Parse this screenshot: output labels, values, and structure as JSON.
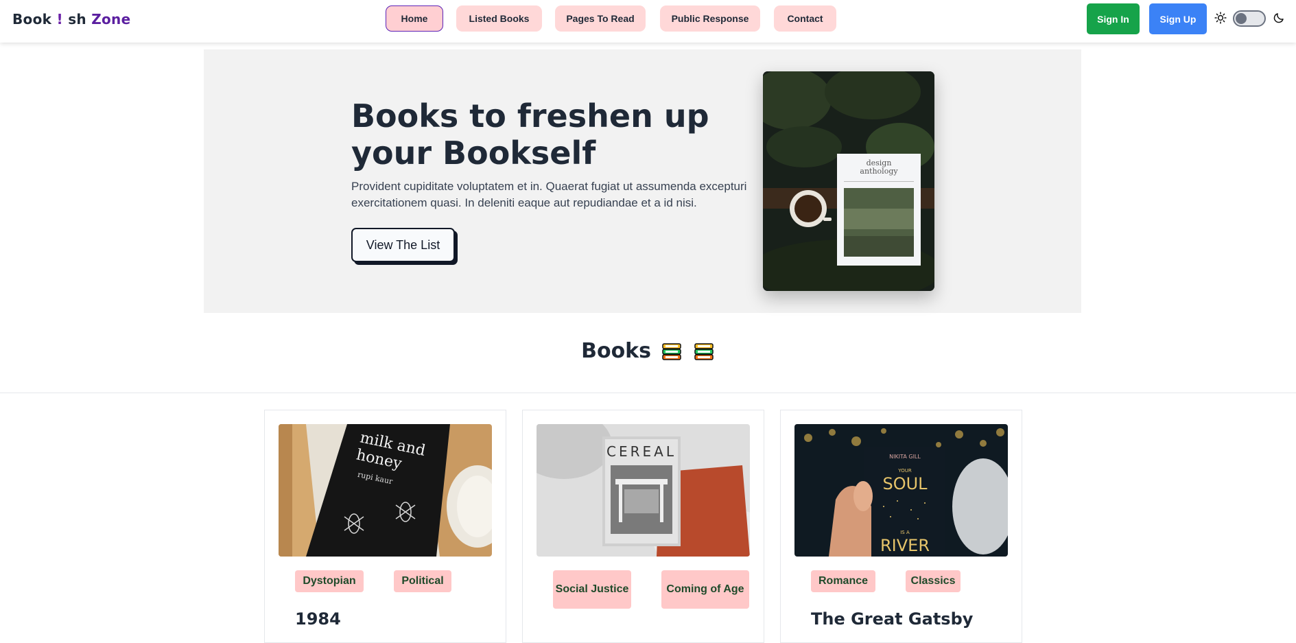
{
  "brand": {
    "part1": "Book",
    "part2": "!",
    "part3": "sh",
    "part4": "Zone"
  },
  "nav": {
    "links": [
      {
        "label": "Home"
      },
      {
        "label": "Listed Books"
      },
      {
        "label": "Pages To Read"
      },
      {
        "label": "Public Response"
      },
      {
        "label": "Contact"
      }
    ],
    "active_index": 0,
    "sign_in": "Sign In",
    "sign_up": "Sign Up",
    "theme_toggle": "light"
  },
  "hero": {
    "title": "Books to freshen up your Bookself",
    "text": "Provident cupiditate voluptatem et in. Quaerat fugiat ut assumenda excepturi exercitationem quasi. In deleniti eaque aut repudiandae et a id nisi.",
    "button": "View The List",
    "image_text": {
      "line1": "design",
      "line2": "anthology"
    }
  },
  "books_section": {
    "title": "Books"
  },
  "books": [
    {
      "title": "1984",
      "tags": [
        "Dystopian",
        "Political"
      ],
      "cover_text": {
        "line1": "milk and",
        "line2": "honey",
        "author": "rupi kaur"
      }
    },
    {
      "title": "",
      "tags": [
        "Social Justice",
        "Coming of Age"
      ],
      "cover_text": {
        "line1": "CEREAL"
      }
    },
    {
      "title": "The Great Gatsby",
      "tags": [
        "Romance",
        "Classics"
      ],
      "cover_text": {
        "author": "NIKITA GILL",
        "line1": "YOUR",
        "line2": "SOUL",
        "line3": "IS A",
        "line4": "RIVER"
      }
    }
  ],
  "colors": {
    "nav_pill": "#ffd8d8",
    "sign_in": "#16a34a",
    "sign_up": "#3b82f6",
    "brand_accent": "#5b1fa0",
    "tag_bg": "#ffc8c8",
    "tag_text": "#1f4a2a"
  }
}
